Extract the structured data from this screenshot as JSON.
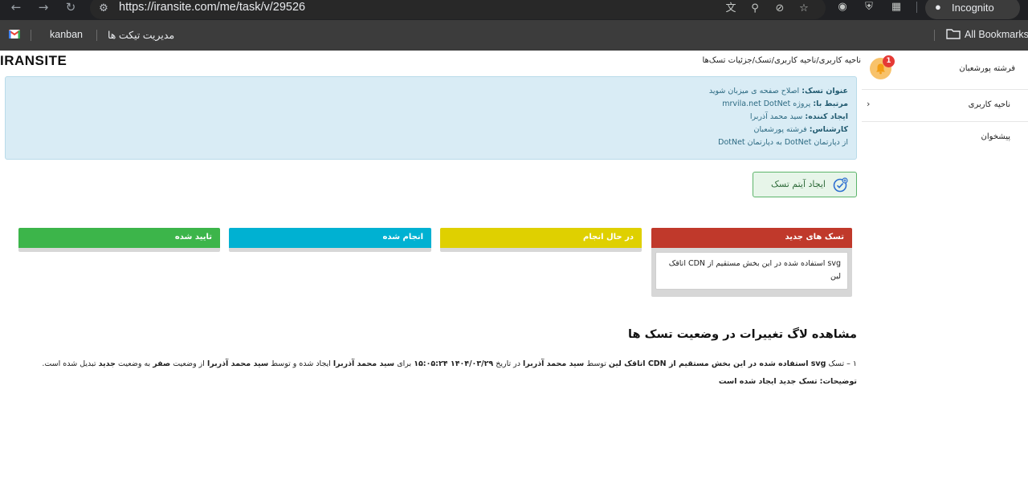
{
  "browser": {
    "url": "https://iransite.com/me/task/v/29526",
    "incognito_label": "Incognito",
    "bookmarks": [
      {
        "label": "kanban"
      },
      {
        "label": "مدیریت تیکت ها"
      }
    ],
    "all_bookmarks": "All Bookmarks"
  },
  "site": {
    "logo": "IRANSITE",
    "breadcrumb": "ناحیه کاربری/ناحیه کاربری/تسک/جزئیات تسک‌ها"
  },
  "task_info": {
    "title_label": "عنوان تسک:",
    "title_value": "اصلاح صفحه ی میزبان شوید",
    "related_label": "مرتبط با:",
    "related_value": "پروژه mrvila.net DotNet",
    "creator_label": "ایجاد کننده:",
    "creator_value": "سید محمد آذربرا",
    "expert_label": "کارشناس:",
    "expert_value": "فرشته پورشعبان",
    "department_note": "از دپارتمان DotNet به دپارتمان DotNet"
  },
  "actions": {
    "create_item": "ایجاد آیتم تسک"
  },
  "board": {
    "new": {
      "title": "تسک های جدید",
      "color": "#c0392b"
    },
    "doing": {
      "title": "در حال انجام",
      "color": "#dfd000"
    },
    "done": {
      "title": "انجام شده",
      "color": "#00b1d2"
    },
    "approved": {
      "title": "تایید شده",
      "color": "#3cb54a"
    },
    "cards": [
      {
        "text": "svg استفاده شده در این بخش مستقیم از CDN اتاقک لین"
      }
    ]
  },
  "log": {
    "title": "مشاهده لاگ تغییرات در وضعیت تسک ها",
    "entry": {
      "index": "۱",
      "t1": "تسک",
      "task": "svg استفاده شده در این بخش مستقیم از CDN اتاقک لین",
      "t2": "توسط",
      "user1": "سید محمد آذربرا",
      "t3": "در تاریخ",
      "datetime": "۱۴۰۴/۰۳/۲۹ ۱۵:۰۵:۲۴",
      "t4": "برای",
      "user2": "سید محمد آذربرا",
      "t5": "ایجاد شده و توسط",
      "user3": "سید محمد آذربرا",
      "t6": "از وضعیت",
      "status_from": "صفر",
      "t7": "به وضعیت",
      "status_to": "جدید",
      "t8": "تبدیل شده است.",
      "desc_label": "توضیحات:",
      "desc_value": "تسک جدید ایجاد شده است"
    }
  },
  "sidebar": {
    "user_name": "فرشته پورشعبان",
    "notification_count": "1",
    "items": [
      {
        "label": "ناحیه کاربری"
      },
      {
        "label": "پیشخوان"
      }
    ]
  }
}
